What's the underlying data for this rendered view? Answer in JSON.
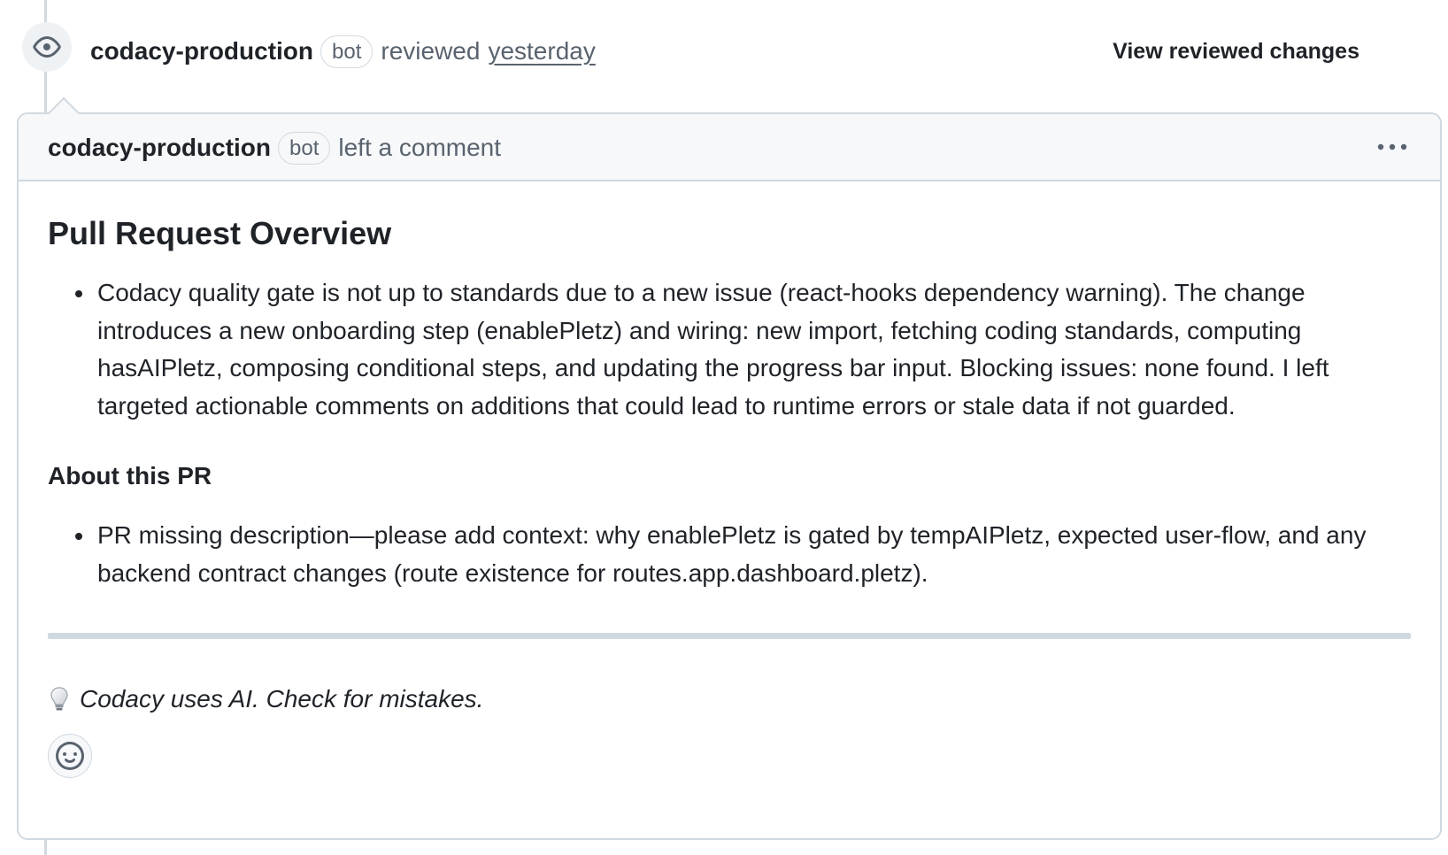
{
  "review": {
    "author": "codacy-production",
    "author_badge": "bot",
    "action": "reviewed",
    "timestamp": "yesterday",
    "view_changes_label": "View reviewed changes"
  },
  "comment": {
    "author": "codacy-production",
    "author_badge": "bot",
    "action": "left a comment",
    "overview_heading": "Pull Request Overview",
    "overview_items": [
      "Codacy quality gate is not up to standards due to a new issue (react-hooks dependency warning). The change introduces a new onboarding step (enablePletz) and wiring: new import, fetching coding standards, computing hasAIPletz, composing conditional steps, and updating the progress bar input. Blocking issues: none found. I left targeted actionable comments on additions that could lead to runtime errors or stale data if not guarded."
    ],
    "about_heading": "About this PR",
    "about_items": [
      "PR missing description—please add context: why enablePletz is gated by tempAIPletz, expected user-flow, and any backend contract changes (route existence for routes.app.dashboard.pletz)."
    ],
    "disclaimer": "Codacy uses AI. Check for mistakes."
  },
  "icons": {
    "review_event": "eye-icon",
    "more_options": "kebab-horizontal-icon",
    "disclaimer": "light-bulb-icon",
    "reaction": "smiley-icon"
  },
  "colors": {
    "text": "#1f2328",
    "muted": "#59636e",
    "border": "#d1d9e0",
    "header_bg": "#f6f8fa"
  }
}
